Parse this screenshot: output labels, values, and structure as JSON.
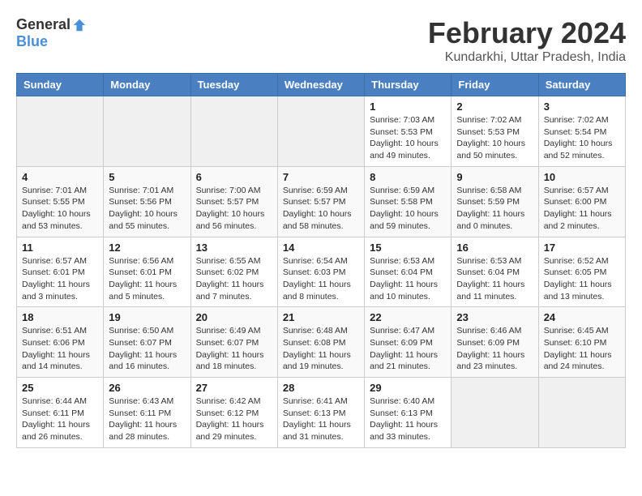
{
  "header": {
    "logo_general": "General",
    "logo_blue": "Blue",
    "month_title": "February 2024",
    "location": "Kundarkhi, Uttar Pradesh, India"
  },
  "calendar": {
    "days_of_week": [
      "Sunday",
      "Monday",
      "Tuesday",
      "Wednesday",
      "Thursday",
      "Friday",
      "Saturday"
    ],
    "weeks": [
      [
        {
          "day": "",
          "info": ""
        },
        {
          "day": "",
          "info": ""
        },
        {
          "day": "",
          "info": ""
        },
        {
          "day": "",
          "info": ""
        },
        {
          "day": "1",
          "info": "Sunrise: 7:03 AM\nSunset: 5:53 PM\nDaylight: 10 hours\nand 49 minutes."
        },
        {
          "day": "2",
          "info": "Sunrise: 7:02 AM\nSunset: 5:53 PM\nDaylight: 10 hours\nand 50 minutes."
        },
        {
          "day": "3",
          "info": "Sunrise: 7:02 AM\nSunset: 5:54 PM\nDaylight: 10 hours\nand 52 minutes."
        }
      ],
      [
        {
          "day": "4",
          "info": "Sunrise: 7:01 AM\nSunset: 5:55 PM\nDaylight: 10 hours\nand 53 minutes."
        },
        {
          "day": "5",
          "info": "Sunrise: 7:01 AM\nSunset: 5:56 PM\nDaylight: 10 hours\nand 55 minutes."
        },
        {
          "day": "6",
          "info": "Sunrise: 7:00 AM\nSunset: 5:57 PM\nDaylight: 10 hours\nand 56 minutes."
        },
        {
          "day": "7",
          "info": "Sunrise: 6:59 AM\nSunset: 5:57 PM\nDaylight: 10 hours\nand 58 minutes."
        },
        {
          "day": "8",
          "info": "Sunrise: 6:59 AM\nSunset: 5:58 PM\nDaylight: 10 hours\nand 59 minutes."
        },
        {
          "day": "9",
          "info": "Sunrise: 6:58 AM\nSunset: 5:59 PM\nDaylight: 11 hours\nand 0 minutes."
        },
        {
          "day": "10",
          "info": "Sunrise: 6:57 AM\nSunset: 6:00 PM\nDaylight: 11 hours\nand 2 minutes."
        }
      ],
      [
        {
          "day": "11",
          "info": "Sunrise: 6:57 AM\nSunset: 6:01 PM\nDaylight: 11 hours\nand 3 minutes."
        },
        {
          "day": "12",
          "info": "Sunrise: 6:56 AM\nSunset: 6:01 PM\nDaylight: 11 hours\nand 5 minutes."
        },
        {
          "day": "13",
          "info": "Sunrise: 6:55 AM\nSunset: 6:02 PM\nDaylight: 11 hours\nand 7 minutes."
        },
        {
          "day": "14",
          "info": "Sunrise: 6:54 AM\nSunset: 6:03 PM\nDaylight: 11 hours\nand 8 minutes."
        },
        {
          "day": "15",
          "info": "Sunrise: 6:53 AM\nSunset: 6:04 PM\nDaylight: 11 hours\nand 10 minutes."
        },
        {
          "day": "16",
          "info": "Sunrise: 6:53 AM\nSunset: 6:04 PM\nDaylight: 11 hours\nand 11 minutes."
        },
        {
          "day": "17",
          "info": "Sunrise: 6:52 AM\nSunset: 6:05 PM\nDaylight: 11 hours\nand 13 minutes."
        }
      ],
      [
        {
          "day": "18",
          "info": "Sunrise: 6:51 AM\nSunset: 6:06 PM\nDaylight: 11 hours\nand 14 minutes."
        },
        {
          "day": "19",
          "info": "Sunrise: 6:50 AM\nSunset: 6:07 PM\nDaylight: 11 hours\nand 16 minutes."
        },
        {
          "day": "20",
          "info": "Sunrise: 6:49 AM\nSunset: 6:07 PM\nDaylight: 11 hours\nand 18 minutes."
        },
        {
          "day": "21",
          "info": "Sunrise: 6:48 AM\nSunset: 6:08 PM\nDaylight: 11 hours\nand 19 minutes."
        },
        {
          "day": "22",
          "info": "Sunrise: 6:47 AM\nSunset: 6:09 PM\nDaylight: 11 hours\nand 21 minutes."
        },
        {
          "day": "23",
          "info": "Sunrise: 6:46 AM\nSunset: 6:09 PM\nDaylight: 11 hours\nand 23 minutes."
        },
        {
          "day": "24",
          "info": "Sunrise: 6:45 AM\nSunset: 6:10 PM\nDaylight: 11 hours\nand 24 minutes."
        }
      ],
      [
        {
          "day": "25",
          "info": "Sunrise: 6:44 AM\nSunset: 6:11 PM\nDaylight: 11 hours\nand 26 minutes."
        },
        {
          "day": "26",
          "info": "Sunrise: 6:43 AM\nSunset: 6:11 PM\nDaylight: 11 hours\nand 28 minutes."
        },
        {
          "day": "27",
          "info": "Sunrise: 6:42 AM\nSunset: 6:12 PM\nDaylight: 11 hours\nand 29 minutes."
        },
        {
          "day": "28",
          "info": "Sunrise: 6:41 AM\nSunset: 6:13 PM\nDaylight: 11 hours\nand 31 minutes."
        },
        {
          "day": "29",
          "info": "Sunrise: 6:40 AM\nSunset: 6:13 PM\nDaylight: 11 hours\nand 33 minutes."
        },
        {
          "day": "",
          "info": ""
        },
        {
          "day": "",
          "info": ""
        }
      ]
    ]
  }
}
